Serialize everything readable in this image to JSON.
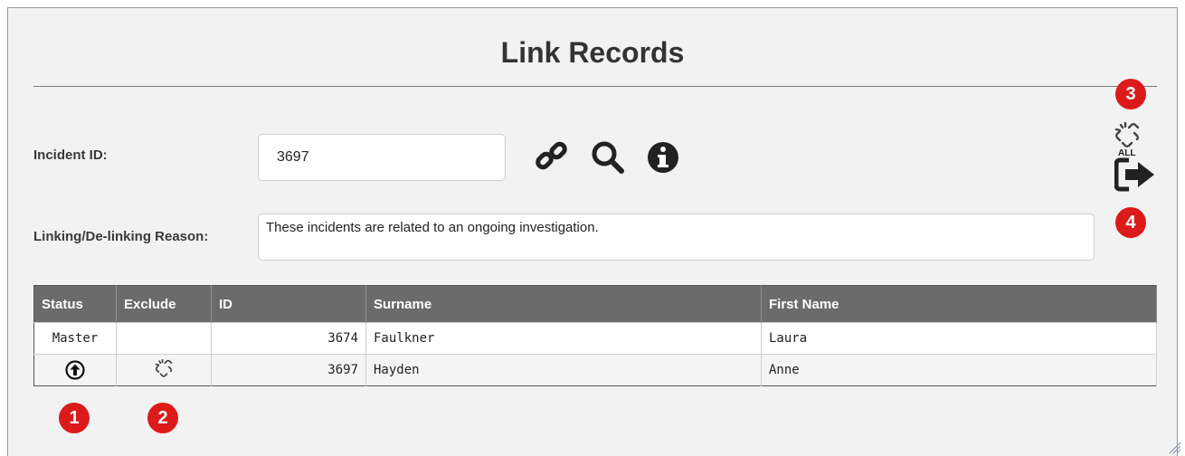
{
  "title": "Link Records",
  "form": {
    "incident_id_label": "Incident ID:",
    "incident_id_value": "3697",
    "reason_label": "Linking/De-linking Reason:",
    "reason_value": "These incidents are related to an ongoing investigation."
  },
  "tools": {
    "icons": [
      "link-icon",
      "search-icon",
      "info-icon",
      "unlink-all-icon",
      "exit-icon"
    ],
    "unlink_all_label": "ALL"
  },
  "badges": [
    "1",
    "2",
    "3",
    "4"
  ],
  "table": {
    "headers": [
      "Status",
      "Exclude",
      "ID",
      "Surname",
      "First Name"
    ],
    "rows": [
      {
        "status": "Master",
        "exclude": "",
        "id": "3674",
        "surname": "Faulkner",
        "first_name": "Laura"
      },
      {
        "status": "promote-icon",
        "exclude": "unlink-icon",
        "id": "3697",
        "surname": "Hayden",
        "first_name": "Anne"
      }
    ]
  },
  "colors": {
    "badge": "#dd1a1a",
    "header_bg": "#6b6b6b",
    "panel_bg": "#f2f2f2"
  }
}
